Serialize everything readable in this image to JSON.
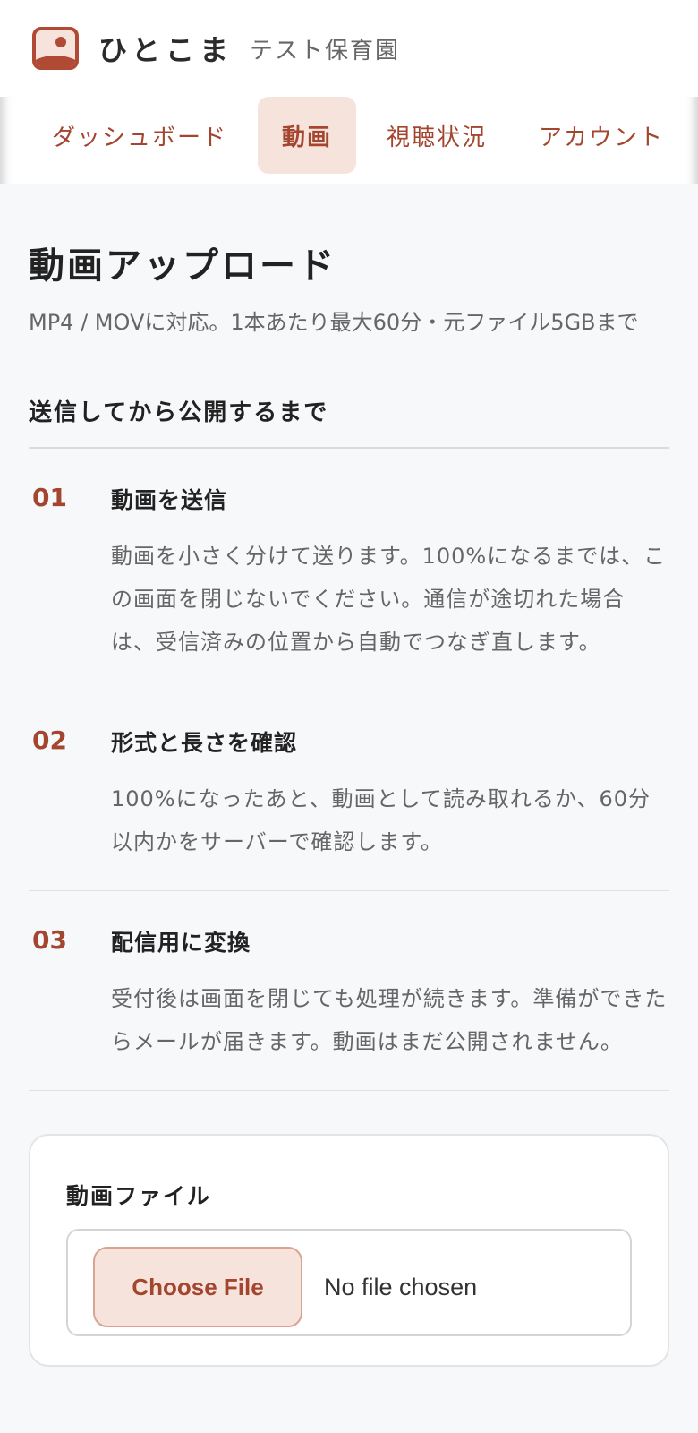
{
  "header": {
    "app_name": "ひとこま",
    "org_name": "テスト保育園"
  },
  "nav": {
    "tabs": [
      {
        "label": "ダッシュボード",
        "active": false
      },
      {
        "label": "動画",
        "active": true
      },
      {
        "label": "視聴状況",
        "active": false
      },
      {
        "label": "アカウント",
        "active": false
      }
    ]
  },
  "main": {
    "title": "動画アップロード",
    "description": "MP4 / MOVに対応。1本あたり最大60分・元ファイル5GBまで",
    "flow_title": "送信してから公開するまで",
    "steps": [
      {
        "num": "01",
        "title": "動画を送信",
        "text": "動画を小さく分けて送ります。100%になるまでは、この画面を閉じないでください。通信が途切れた場合は、受信済みの位置から自動でつなぎ直します。"
      },
      {
        "num": "02",
        "title": "形式と長さを確認",
        "text": "100%になったあと、動画として読み取れるか、60分以内かをサーバーで確認します。"
      },
      {
        "num": "03",
        "title": "配信用に変換",
        "text": "受付後は画面を閉じても処理が続きます。準備ができたらメールが届きます。動画はまだ公開されません。"
      }
    ],
    "upload": {
      "field_label": "動画ファイル",
      "choose_label": "Choose File",
      "status": "No file chosen"
    }
  },
  "colors": {
    "accent": "#a3452f",
    "accent_bg": "#f6e4dc",
    "page_bg": "#f7f8fa"
  }
}
